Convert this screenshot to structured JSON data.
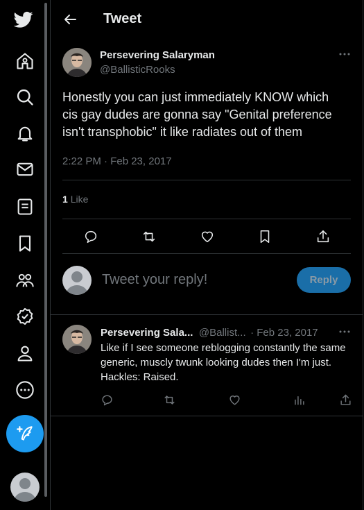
{
  "header": {
    "title": "Tweet"
  },
  "nav": [
    "twitter-logo",
    "home",
    "explore",
    "notifications",
    "messages",
    "lists",
    "bookmarks",
    "communities",
    "verified",
    "profile",
    "more"
  ],
  "tweet": {
    "author_name": "Persevering Salaryman",
    "author_handle": "@BallisticRooks",
    "text": "Honestly you can just immediately KNOW which cis gay dudes are gonna say \"Genital preference isn't transphobic\" it like radiates out of them",
    "timestamp": "2:22 PM · Feb 23, 2017",
    "likes_count": "1",
    "likes_label": "Like"
  },
  "reply_box": {
    "placeholder": "Tweet your reply!",
    "button_label": "Reply"
  },
  "reply": {
    "author_name": "Persevering Sala...",
    "author_handle": "@Ballist...",
    "date": "· Feb 23, 2017",
    "text": "Like if I see someone reblogging constantly the same generic, muscly twunk looking dudes then I'm just. Hackles: Raised."
  },
  "colors": {
    "accent": "#1d9bf0",
    "background": "#000000",
    "muted": "#71767b",
    "text": "#e7e9ea"
  }
}
